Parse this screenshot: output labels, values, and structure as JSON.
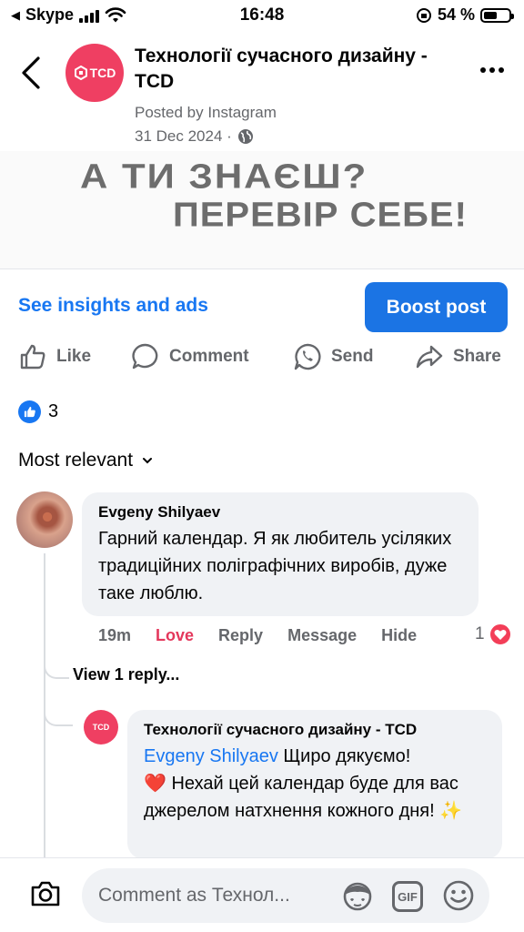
{
  "status_bar": {
    "carrier": "Skype",
    "time": "16:48",
    "battery": "54 %",
    "battery_level": 0.54
  },
  "header": {
    "page_name": "Технології сучасного дизайну - TCD",
    "avatar_label": "TCD",
    "posted_by": "Posted by Instagram",
    "date": "31 Dec 2024 ·"
  },
  "post_image": {
    "line1": "А ТИ ЗНАЄШ?",
    "line2": "ПЕРЕВІР СЕБЕ!"
  },
  "insights": {
    "link": "See insights and ads",
    "boost_button": "Boost post"
  },
  "actions": {
    "like": "Like",
    "comment": "Comment",
    "send": "Send",
    "share": "Share"
  },
  "reactions": {
    "count": "3"
  },
  "sort": {
    "label": "Most relevant"
  },
  "comment": {
    "author": "Evgeny Shilyaev",
    "text": "Гарний календар. Я як любитель усіляких традиційних поліграфічних виробів, дуже таке люблю.",
    "time": "19m",
    "reaction_button": "Love",
    "reply": "Reply",
    "message": "Message",
    "hide": "Hide",
    "reaction_count": "1"
  },
  "replies": {
    "view_label": "View 1 reply...",
    "reply": {
      "author": "Технології сучасного дизайну - TCD",
      "avatar_label": "TCD",
      "mention": "Evgeny Shilyaev",
      "text_after_mention": " Щиро дякуємо!",
      "text_line2": "❤️ Нехай цей календар буде для вас джерелом натхнення кожного дня! ✨"
    }
  },
  "composer": {
    "placeholder": "Comment as Технол..."
  },
  "colors": {
    "brand_blue": "#1877f2",
    "boost_blue": "#1b74e4",
    "love_red": "#e4385c",
    "tcd_pink": "#ef3f62",
    "bubble_bg": "#f0f2f5",
    "muted_text": "#65676b"
  }
}
